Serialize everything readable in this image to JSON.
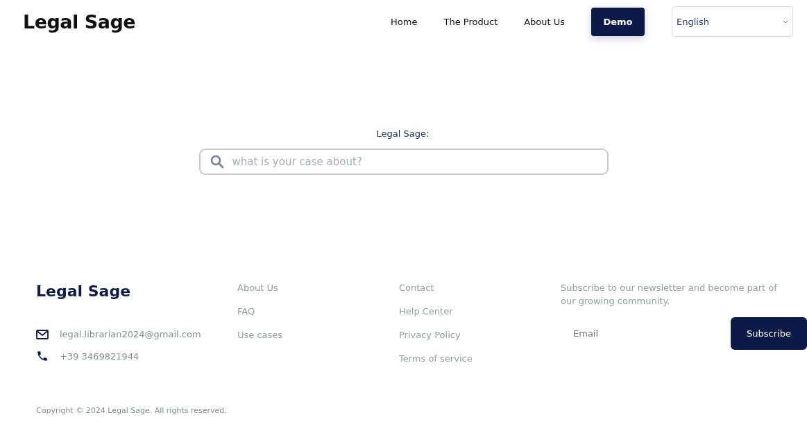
{
  "header": {
    "logo": "Legal Sage",
    "nav": [
      {
        "label": "Home",
        "kind": "link"
      },
      {
        "label": "The Product",
        "kind": "link"
      },
      {
        "label": "About Us",
        "kind": "link"
      },
      {
        "label": "Demo",
        "kind": "button"
      }
    ],
    "language": {
      "value": "English"
    }
  },
  "search": {
    "label": "Legal Sage:",
    "placeholder": "what is your case about?"
  },
  "footer": {
    "logo": "Legal Sage",
    "contacts": [
      {
        "kind": "email",
        "text": "legal.librarian2024@gmail.com"
      },
      {
        "kind": "phone",
        "text": "+39 3469821944"
      }
    ],
    "link_columns": [
      [
        "About Us",
        "FAQ",
        "Use cases"
      ],
      [
        "Contact",
        "Help Center",
        "Privacy Policy",
        "Terms of service"
      ]
    ],
    "newsletter": {
      "text": "Subscribe to our newsletter and become part of our growing community.",
      "email_placeholder": "Email",
      "button": "Subscribe"
    },
    "copyright": "Copyright © 2024 Legal Sage. All rights reserved."
  }
}
